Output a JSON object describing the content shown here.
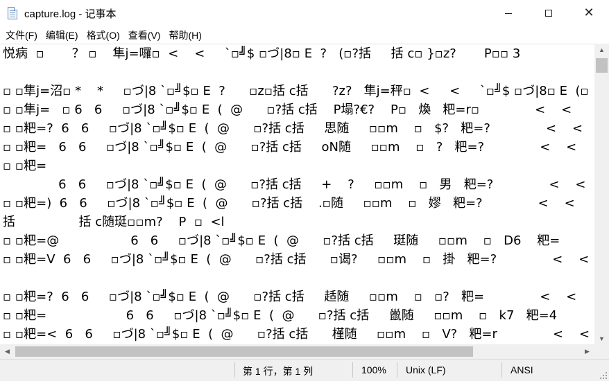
{
  "window": {
    "title": "capture.log - 记事本",
    "minimize_glyph": "—",
    "close_glyph": "✕"
  },
  "menu": [
    {
      "label": "文件(F)"
    },
    {
      "label": "编辑(E)"
    },
    {
      "label": "格式(O)"
    },
    {
      "label": "查看(V)"
    },
    {
      "label": "帮助(H)"
    }
  ],
  "document": {
    "lines": [
      "悦病  ▫       ？ ▫    隼j=囉▫  <    <     `▫╝$ ▫づ|8▫ E  ?   (▫?括     括 c▫ }▫z?       P▫▫ 3",
      "",
      "▫ ▫隼j=沼▫ *    *     ▫づ|8 `▫╝$▫ E  ?      ▫z▫括 c括      ?z?   隼j=秤▫  <     <     `▫╝$ ▫づ|8▫ E  (▫",
      "▫ ▫隼j=   ▫ 6   6     ▫づ|8 `▫╝$▫ E  (  @      ▫?括 c括    P塌?€?    P▫   煥   粑=r▫              <    <",
      "▫ ▫粑=?  6   6     ▫づ|8 `▫╝$▫ E  (  @      ▫?括 c括     思随     ▫▫m    ▫   $?   粑=?              <    <",
      "▫ ▫粑=   6   6     ▫づ|8 `▫╝$▫ E  (  @      ▫?括 c括     oN随     ▫▫m    ▫   ?   粑=?              <    <",
      "▫ ▫粑=",
      "              6   6     ▫づ|8 `▫╝$▫ E  (  @      ▫?括 c括     +    ?     ▫▫m    ▫   男   粑=?              <    <",
      "▫ ▫粑=)  6   6     ▫づ|8 `▫╝$▫ E  (  @      ▫?括 c括    .▫随     ▫▫m    ▫   嫪   粑=?              <    <",
      "括                括 c随珽▫▫m?    P  ▫  <l",
      "▫ ▫粑=@                  6   6     ▫づ|8 `▫╝$▫ E  (  @      ▫?括 c括     珽随     ▫▫m    ▫   D6    粑=",
      "▫ ▫粑=V  6   6     ▫づ|8 `▫╝$▫ E  (  @      ▫?括 c括      ▫谒?     ▫▫m    ▫   掛   粑=?              <    <",
      "",
      "▫ ▫粑=?  6   6     ▫づ|8 `▫╝$▫ E  (  @      ▫?括 c括     趏随     ▫▫m    ▫   ▫?   粑=              <    <",
      "▫ ▫粑=                    6   6     ▫づ|8 `▫╝$▫ E  (  @      ▫?括 c括     巤随     ▫▫m    ▫   k7   粑=4",
      "▫ ▫粑=<  6   6     ▫づ|8 `▫╝$▫ E  (  @      ▫?括 c括      槿随     ▫▫m    ▫   V?   粑=r              <    <"
    ]
  },
  "scrollbar": {
    "up_glyph": "▲",
    "down_glyph": "▼",
    "left_glyph": "◀",
    "right_glyph": "▶"
  },
  "status": {
    "position": "第 1 行，第 1 列",
    "zoom": "100%",
    "line_ending": "Unix (LF)",
    "encoding": "ANSI"
  }
}
